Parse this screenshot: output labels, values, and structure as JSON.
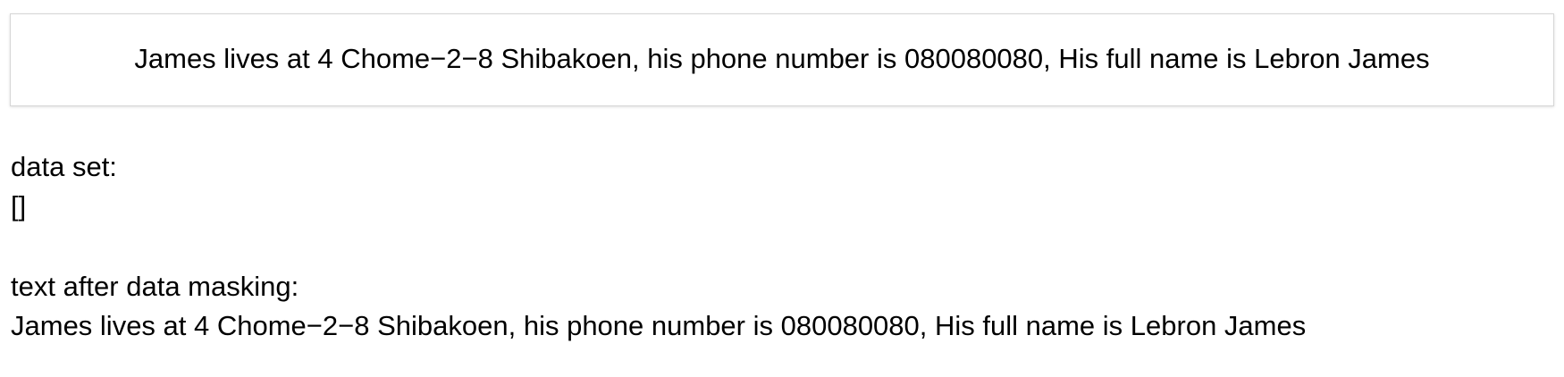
{
  "input": {
    "text": "James lives at 4 Chome−2−8 Shibakoen, his phone number is 080080080, His full name is Lebron James"
  },
  "result": {
    "data_set_label": "data set:",
    "data_set_value": "[]",
    "masked_label": "text after data masking:",
    "masked_text": "James lives at 4 Chome−2−8 Shibakoen, his phone number is 080080080, His full name is Lebron James"
  }
}
